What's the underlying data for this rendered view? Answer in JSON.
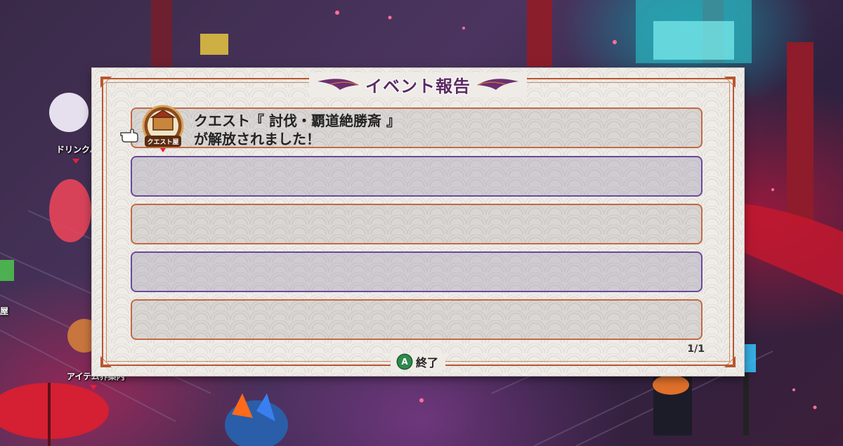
{
  "dialog": {
    "title": "イベント報告",
    "rows": [
      {
        "line1": "クエスト『 討伐・覇道絶勝斎 』",
        "line2": "が解放されました！",
        "icon": "quest-shop-icon",
        "icon_label": "クエスト屋",
        "style": "orange"
      },
      {
        "line1": "",
        "line2": "",
        "style": "purple"
      },
      {
        "line1": "",
        "line2": "",
        "style": "orange"
      },
      {
        "line1": "",
        "line2": "",
        "style": "purple"
      },
      {
        "line1": "",
        "line2": "",
        "style": "orange"
      }
    ],
    "footer": {
      "button": "A",
      "label": "終了"
    },
    "page": "1/1"
  },
  "background": {
    "npc_labels": [
      "ドリンクバー",
      "アイテム界案内",
      "屋"
    ]
  },
  "colors": {
    "title_purple": "#5b2a63",
    "frame_orange": "#b8572e",
    "row_orange": "#c26a45",
    "row_purple": "#6a4a9a",
    "button_green": "#2e8a4d"
  }
}
